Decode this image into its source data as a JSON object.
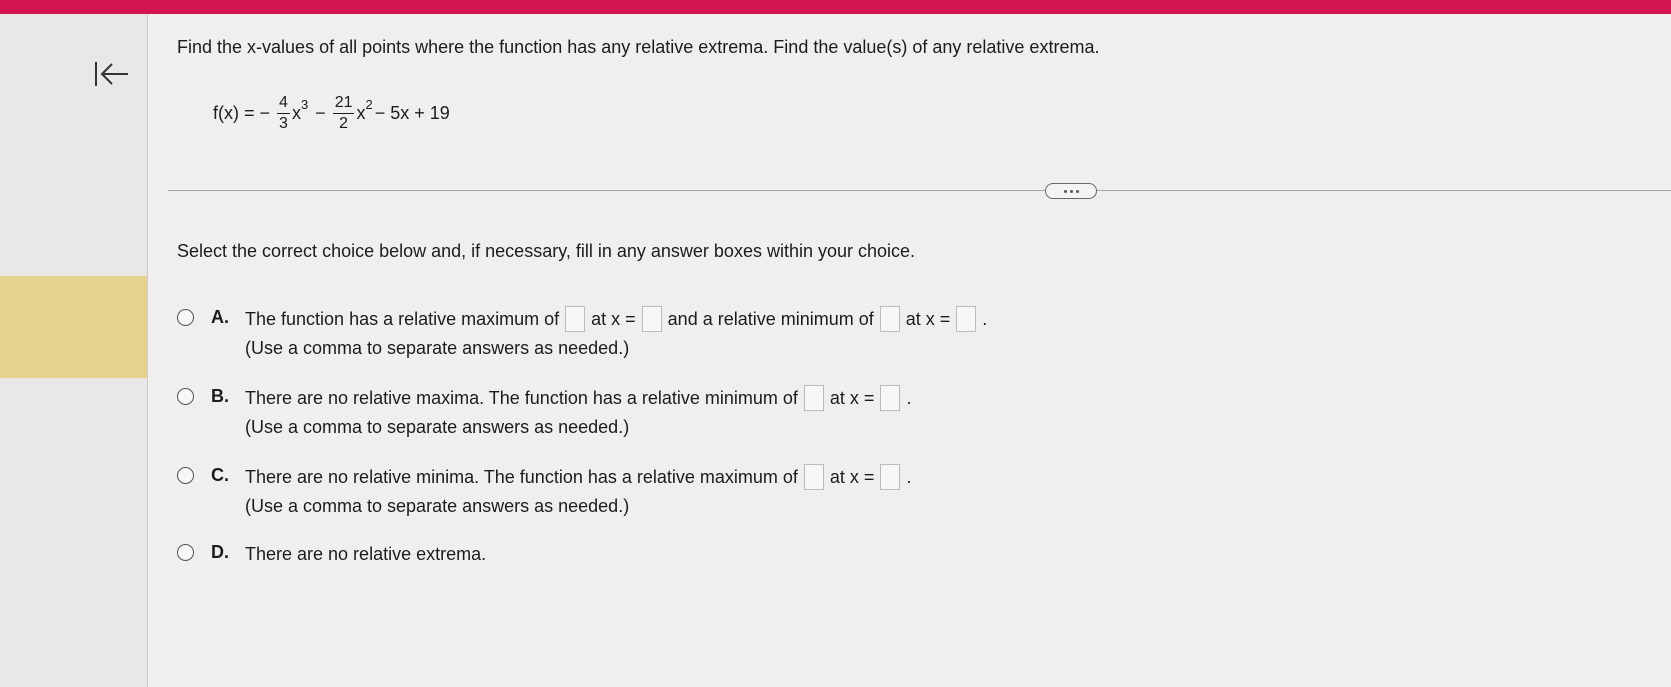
{
  "colors": {
    "topbar": "#d2164f",
    "highlight": "#e6d48e"
  },
  "nav": {
    "back_icon": "arrow-left-to-bar-icon"
  },
  "question": {
    "prompt": "Find the x-values of all points where the function has any relative extrema. Find the value(s) of any relative extrema.",
    "formula": {
      "lhs": "f(x) =",
      "minus1": "−",
      "frac1_num": "4",
      "frac1_den": "3",
      "var1": "x",
      "exp1": "3",
      "minus2": "−",
      "frac2_num": "21",
      "frac2_den": "2",
      "var2": "x",
      "exp2": "2",
      "rest": "− 5x + 19"
    }
  },
  "instruction": "Select the correct choice below and, if necessary, fill in any answer boxes within your choice.",
  "choices": {
    "a": {
      "letter": "A.",
      "t1": "The function has a relative maximum of",
      "t2": "at x =",
      "t3": "and a relative minimum of",
      "t4": "at x =",
      "t5": ".",
      "note": "(Use a comma to separate answers as needed.)"
    },
    "b": {
      "letter": "B.",
      "t1": "There are no relative maxima. The function has a relative minimum of",
      "t2": "at x =",
      "t3": ".",
      "note": "(Use a comma to separate answers as needed.)"
    },
    "c": {
      "letter": "C.",
      "t1": "There are no relative minima. The function has a relative maximum of",
      "t2": "at x =",
      "t3": ".",
      "note": "(Use a comma to separate answers as needed.)"
    },
    "d": {
      "letter": "D.",
      "t1": "There are no relative extrema."
    }
  }
}
